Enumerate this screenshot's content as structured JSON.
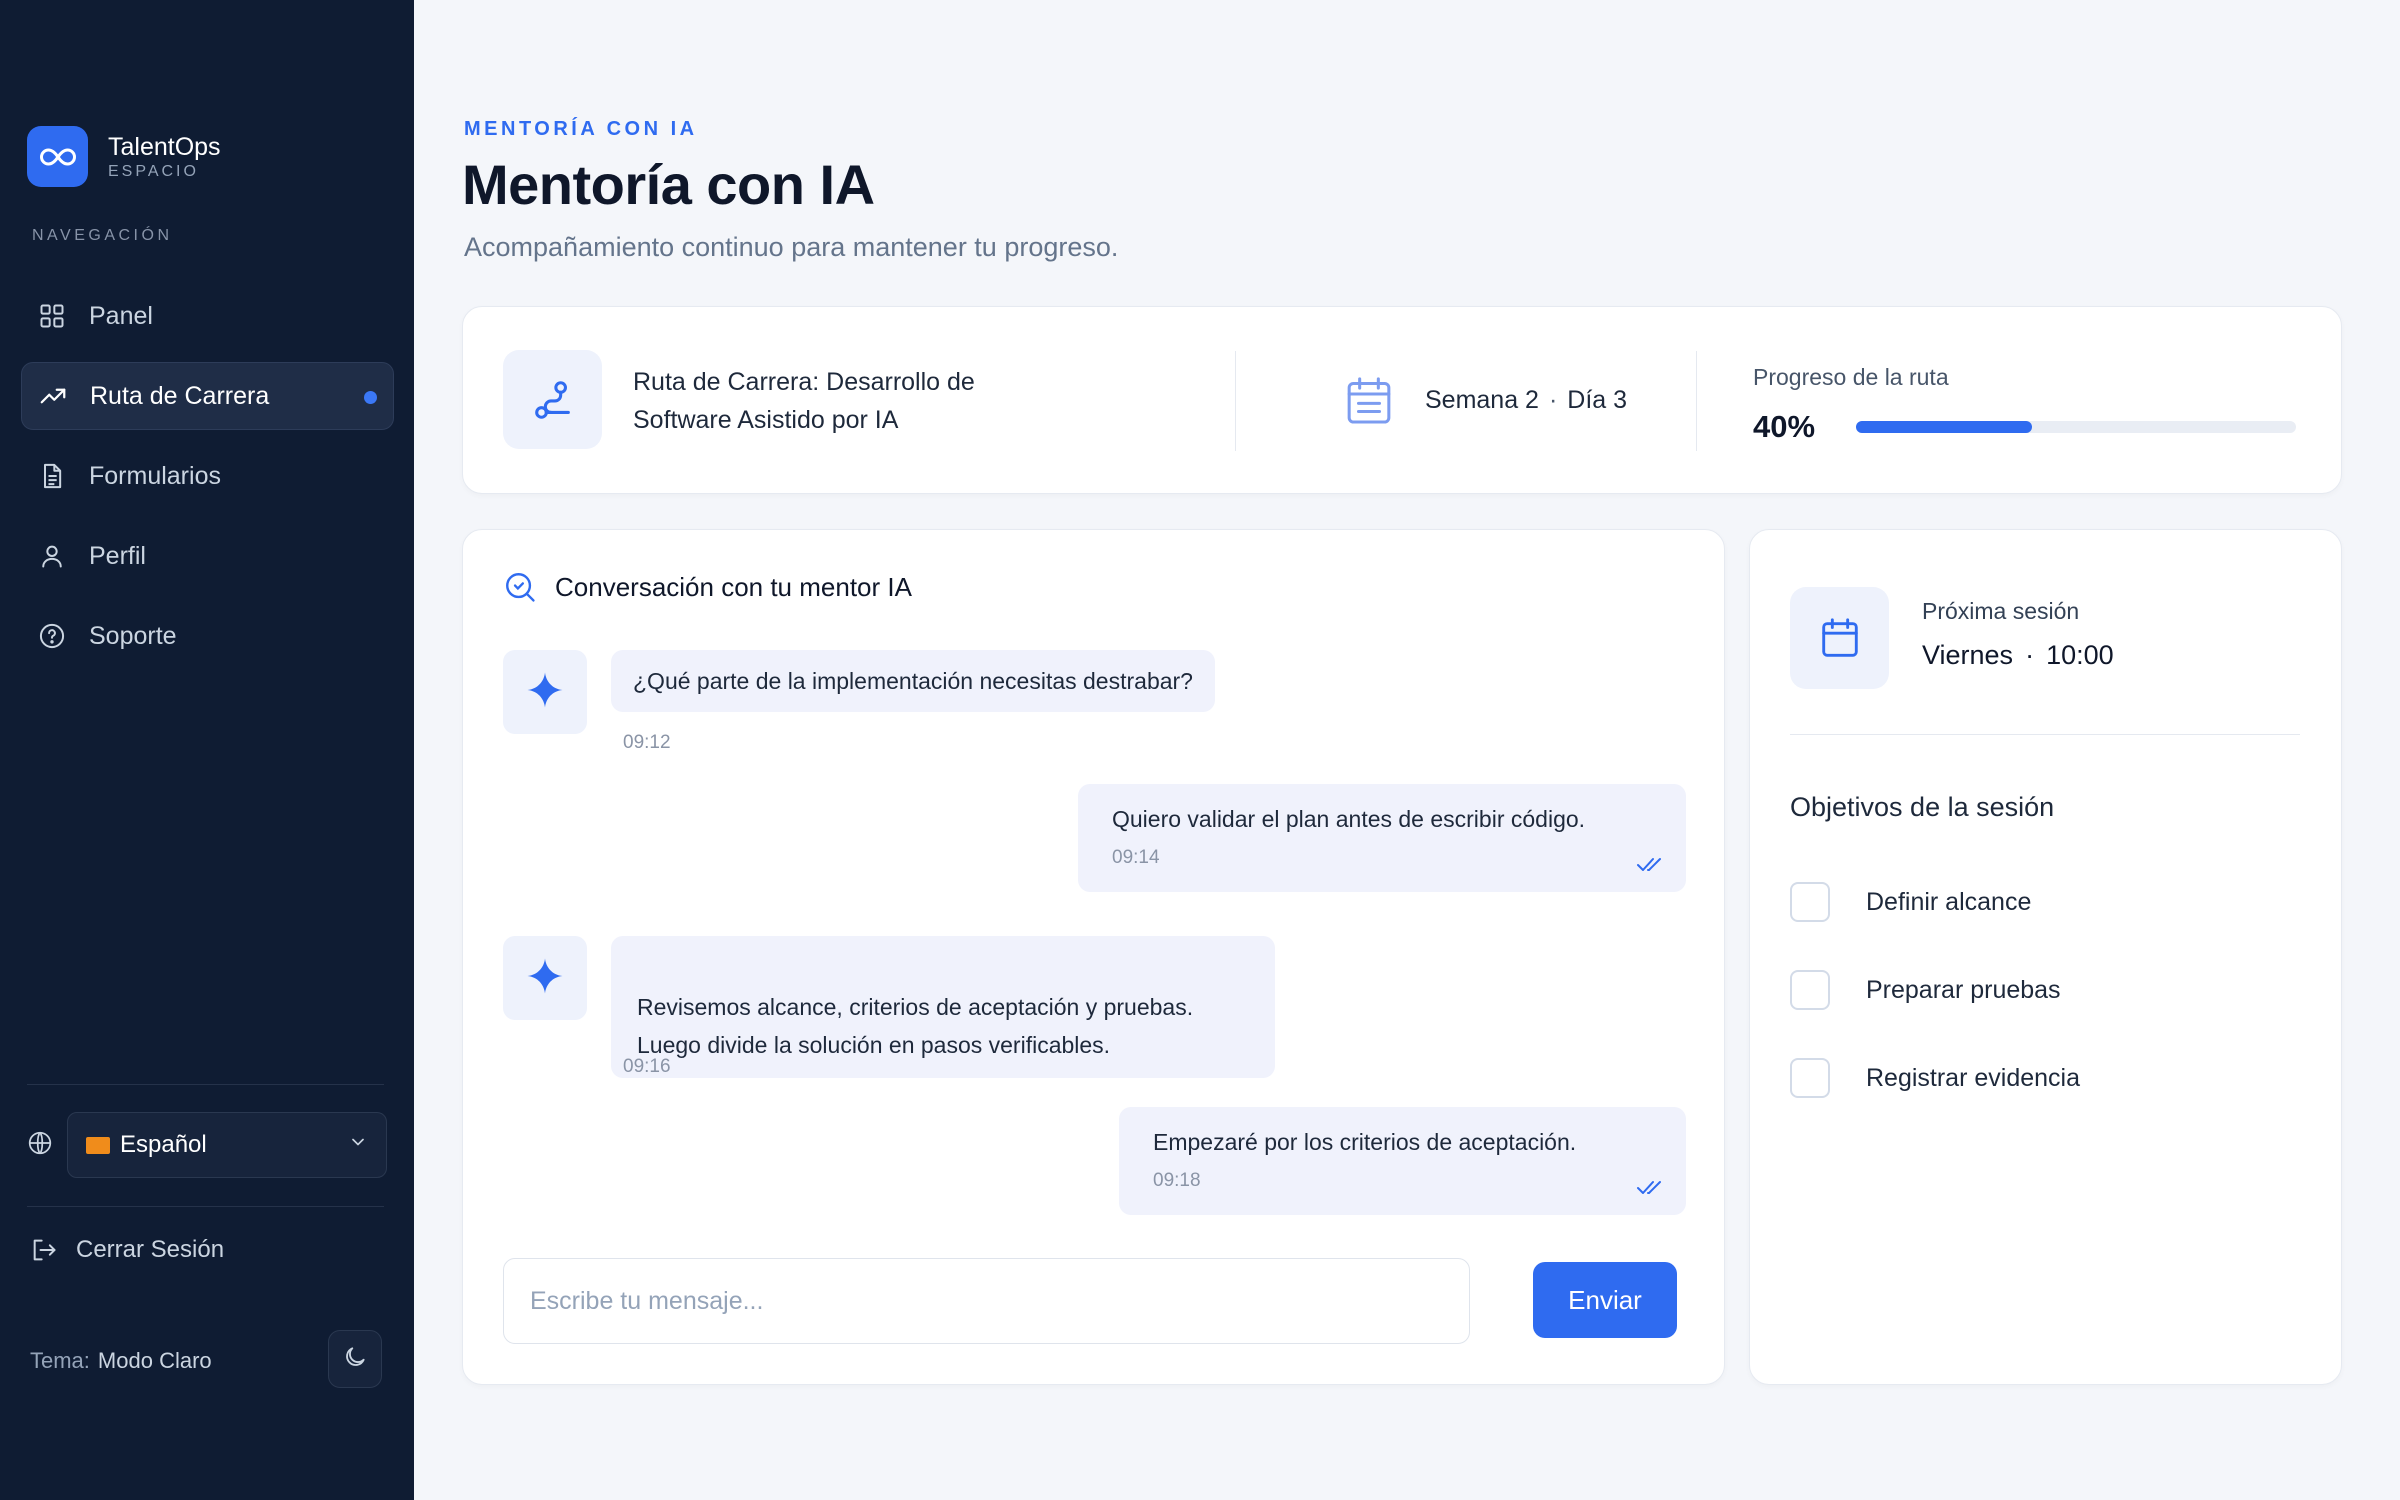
{
  "brand": {
    "name": "TalentOps",
    "subtitle": "ESPACIO"
  },
  "sidebar": {
    "nav_heading": "NAVEGACIÓN",
    "items": [
      {
        "label": "Panel",
        "icon": "grid-icon",
        "active": false
      },
      {
        "label": "Ruta de Carrera",
        "icon": "trending-up-icon",
        "active": true
      },
      {
        "label": "Formularios",
        "icon": "document-icon",
        "active": false
      },
      {
        "label": "Perfil",
        "icon": "user-icon",
        "active": false
      },
      {
        "label": "Soporte",
        "icon": "help-circle-icon",
        "active": false
      }
    ],
    "language": "Español",
    "logout_label": "Cerrar Sesión",
    "theme_label": "Tema:",
    "theme_value": "Modo Claro"
  },
  "header": {
    "eyebrow": "MENTORÍA CON IA",
    "title": "Mentoría con IA",
    "subtitle": "Acompañamiento continuo para mantener tu progreso."
  },
  "route": {
    "title": "Ruta de Carrera: Desarrollo de Software Asistido por IA",
    "week": "Semana 2",
    "day": "Día 3",
    "progress_label": "Progreso de la ruta",
    "progress_text": "40%",
    "progress_value": 0.4
  },
  "chat": {
    "title": "Conversación con tu mentor IA",
    "messages": [
      {
        "sender": "ai",
        "text": "¿Qué parte de la implementación necesitas destrabar?",
        "time": "09:12"
      },
      {
        "sender": "user",
        "text": "Quiero validar el plan antes de escribir código.",
        "time": "09:14",
        "read": true
      },
      {
        "sender": "ai",
        "text": "Revisemos alcance, criterios de aceptación y pruebas.\nLuego divide la solución en pasos verificables.",
        "time": "09:16"
      },
      {
        "sender": "user",
        "text": "Empezaré por los criterios de aceptación.",
        "time": "09:18",
        "read": true
      }
    ],
    "input_placeholder": "Escribe tu mensaje...",
    "send_label": "Enviar"
  },
  "session": {
    "label": "Próxima sesión",
    "day": "Viernes",
    "time": "10:00",
    "objectives_title": "Objetivos de la sesión",
    "objectives": [
      {
        "label": "Definir alcance",
        "checked": false
      },
      {
        "label": "Preparar pruebas",
        "checked": false
      },
      {
        "label": "Registrar evidencia",
        "checked": false
      }
    ]
  },
  "colors": {
    "sidebar_bg": "#0f1c33",
    "accent": "#2f6bf0",
    "page_bg": "#f4f6fa",
    "bubble_bg": "#f0f2fc",
    "flag": "#f08c1b"
  }
}
